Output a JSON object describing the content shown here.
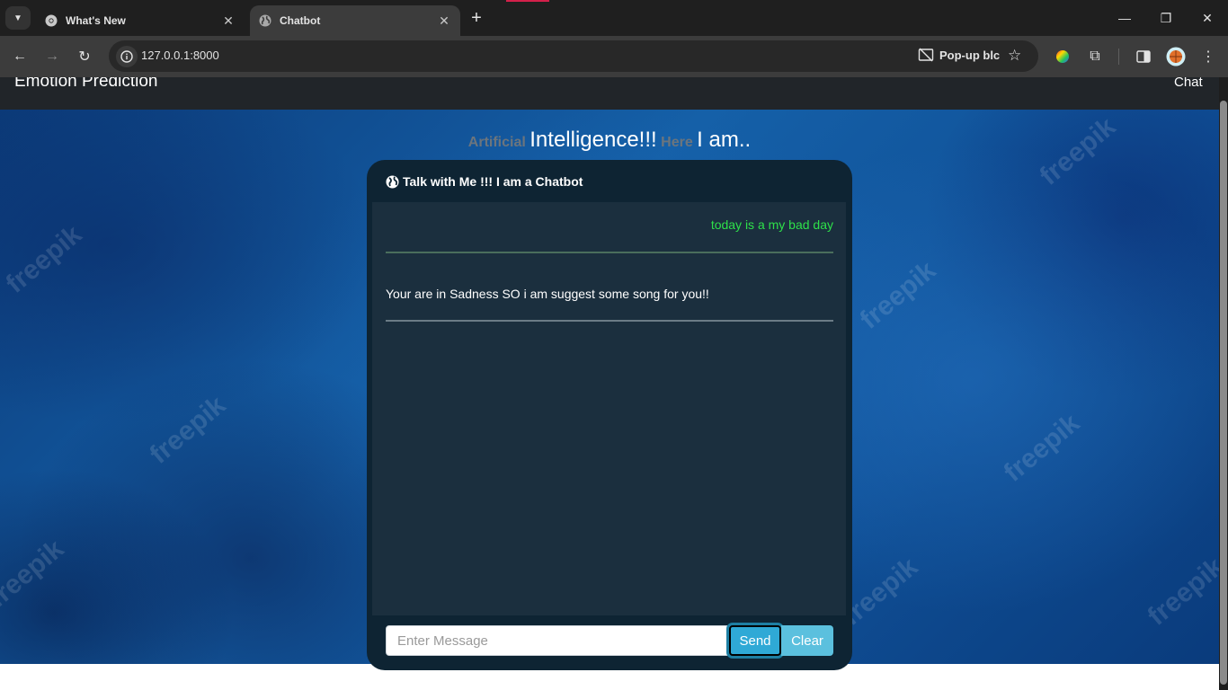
{
  "browser": {
    "tabs": [
      {
        "title": "What's New",
        "icon": "chrome-icon",
        "active": false
      },
      {
        "title": "Chatbot",
        "icon": "globe-icon",
        "active": true
      }
    ],
    "url": "127.0.0.1:8000",
    "popup_blocked_label": "Pop-up blc",
    "window_controls": {
      "minimize": "—",
      "restore": "❐",
      "close": "✕"
    }
  },
  "site": {
    "brand": "Emotion Prediction",
    "nav_link": "Chat"
  },
  "headline": {
    "part1": "Artificial",
    "part2": "Intelligence!!!",
    "part3": "Here",
    "part4": "I am.."
  },
  "chat": {
    "header_title": "Talk with Me !!! I am a Chatbot",
    "header_icon": "globe-icon",
    "messages": [
      {
        "sender": "user",
        "text": "today is a my bad day",
        "color": "#2ee04a"
      },
      {
        "sender": "bot",
        "text": "Your are in Sadness SO i am suggest some song for you!!",
        "color": "#ffffff"
      }
    ],
    "input_placeholder": "Enter Message",
    "input_value": "",
    "send_label": "Send",
    "clear_label": "Clear"
  },
  "watermark_text": "freepik",
  "colors": {
    "card_bg": "#0e2433",
    "chat_bg": "#1b2f3e",
    "send_bg": "#2fa9d6",
    "clear_bg": "#5bc0de",
    "navbar_bg": "#212529"
  }
}
